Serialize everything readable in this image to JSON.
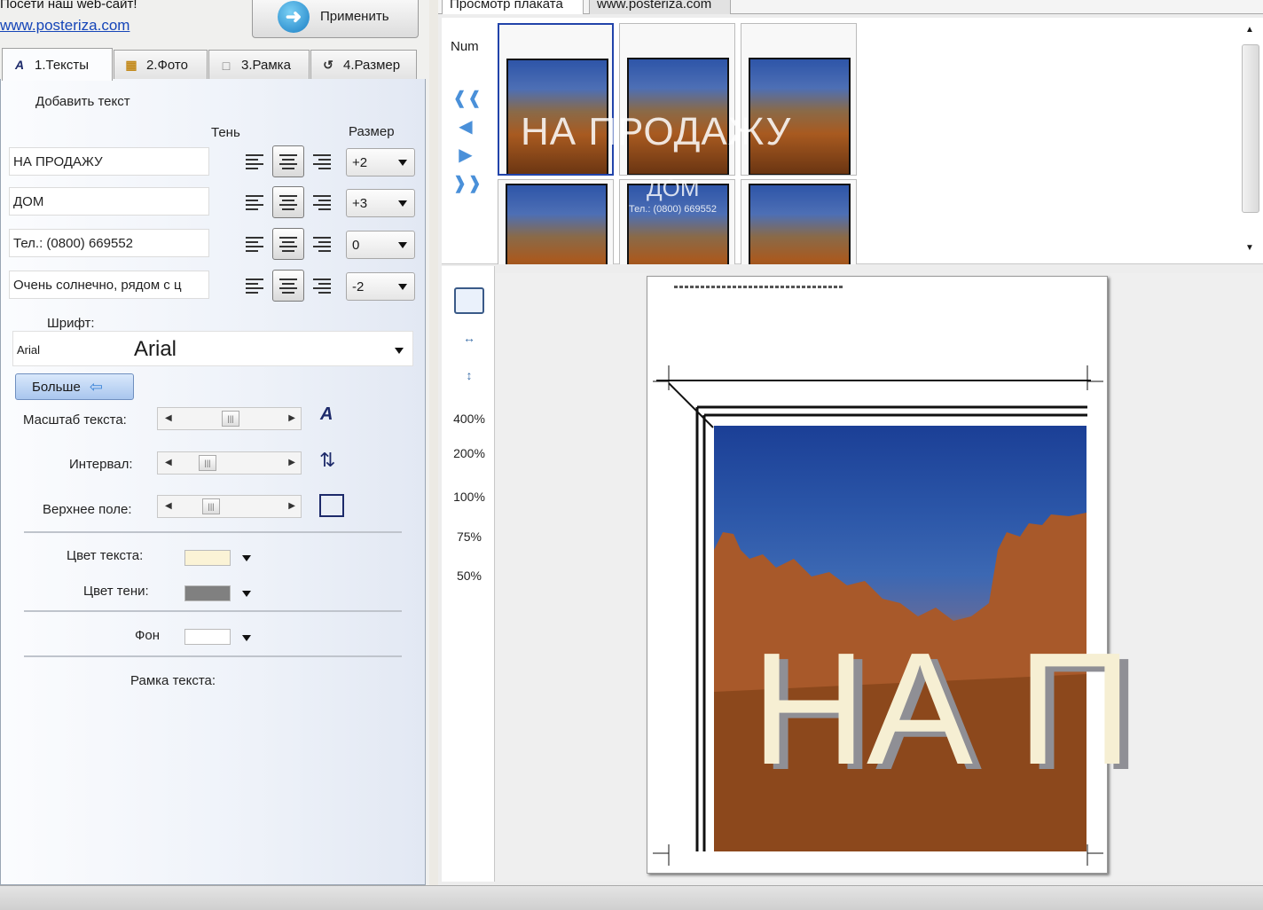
{
  "promo": {
    "label": "Посети наш web-сайт!",
    "link": "www.posteriza.com"
  },
  "apply_label": "Применить",
  "tabs": [
    {
      "label": "1.Тексты"
    },
    {
      "label": "2.Фото"
    },
    {
      "label": "3.Рамка"
    },
    {
      "label": "4.Размер"
    }
  ],
  "texts_tab": {
    "add_text": "Добавить текст",
    "shadow_header": "Тень",
    "size_header": "Размер",
    "rows": [
      {
        "value": "НА ПРОДАЖУ",
        "size": "+2"
      },
      {
        "value": "ДОМ",
        "size": "+3"
      },
      {
        "value": "Тел.: (0800) 669552",
        "size": "0"
      },
      {
        "value": "Очень солнечно, рядом с ц",
        "size": "-2"
      }
    ],
    "font_label": "Шрифт:",
    "font_small": "Arial",
    "font_value": "Arial",
    "more_label": "Больше",
    "scale_label": "Масштаб текста:",
    "interval_label": "Интервал:",
    "top_margin_label": "Верхнее поле:",
    "text_color_label": "Цвет текста:",
    "shadow_color_label": "Цвет тени:",
    "background_label": "Фон",
    "frame_label": "Рамка текста:",
    "colors": {
      "text": "#fbf3d6",
      "shadow": "#808080",
      "background": "#ffffff"
    }
  },
  "preview": {
    "tab_label": "Просмотр плаката",
    "site_tab": "www.posteriza.com",
    "num_label": "Num",
    "poster_line1": "НА ПРОДАЖУ",
    "poster_line2": "ДОМ",
    "poster_line3": "Тел.: (0800) 669552",
    "big_text": "НА П"
  },
  "zoom_levels": [
    "400%",
    "200%",
    "100%",
    "75%",
    "50%"
  ]
}
